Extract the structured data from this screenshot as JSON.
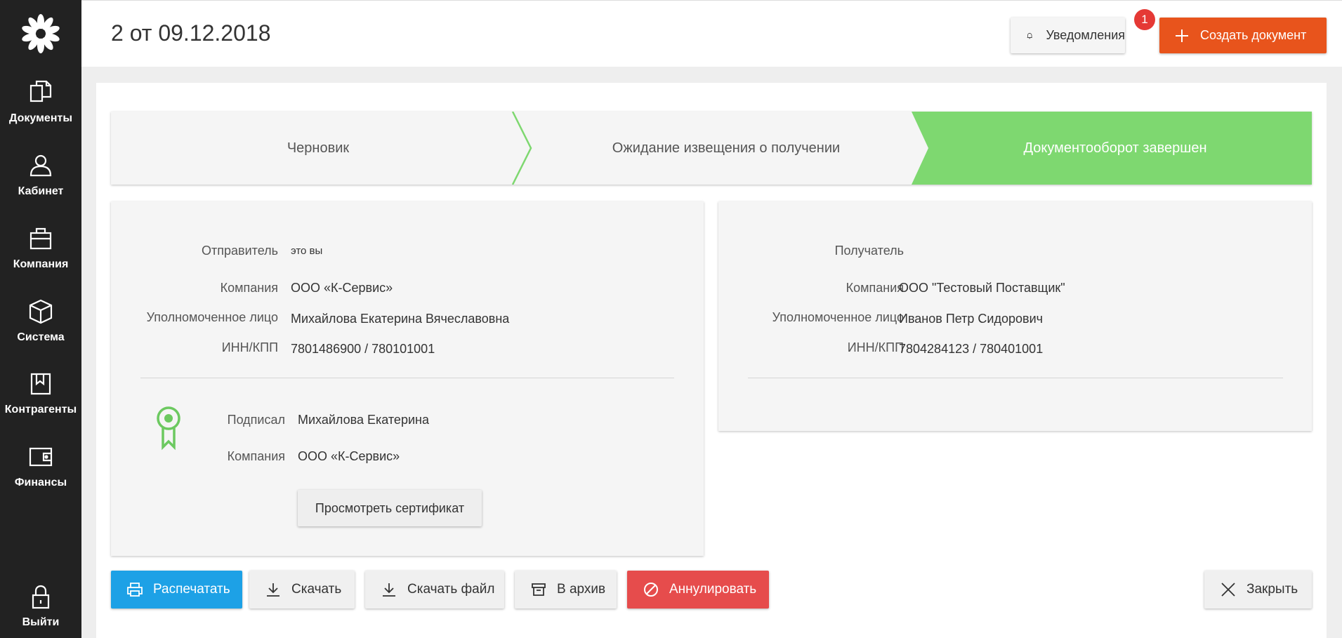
{
  "header": {
    "title": "2 от 09.12.2018",
    "notifications_label": "Уведомления",
    "notifications_count": "1",
    "create_label": "Создать документ"
  },
  "sidebar": {
    "items": [
      {
        "label": "Документы",
        "icon": "documents-icon"
      },
      {
        "label": "Кабинет",
        "icon": "user-icon"
      },
      {
        "label": "Компания",
        "icon": "briefcase-icon"
      },
      {
        "label": "Система",
        "icon": "box-icon"
      },
      {
        "label": "Контрагенты",
        "icon": "bookmark-book-icon"
      },
      {
        "label": "Финансы",
        "icon": "wallet-icon"
      }
    ],
    "logout_label": "Выйти"
  },
  "stepper": {
    "steps": [
      {
        "label": "Черновик",
        "state": "done"
      },
      {
        "label": "Ожидание извещения о получении",
        "state": "done"
      },
      {
        "label": "Документооборот завершен",
        "state": "active"
      }
    ],
    "active_color": "#7ed870"
  },
  "sender": {
    "title_label": "Отправитель",
    "title_value": "это вы",
    "company_label": "Компания",
    "company_value": "ООО «К-Сервис»",
    "person_label": "Уполномоченное лицо",
    "person_value": "Михайлова Екатерина Вячеславовна",
    "inn_label": "ИНН/КПП",
    "inn_value": "7801486900 / 780101001",
    "signed_label": "Подписал",
    "signed_value": "Михайлова Екатерина",
    "sign_company_label": "Компания",
    "sign_company_value": "ООО «К-Сервис»",
    "cert_button": "Просмотреть сертификат"
  },
  "recipient": {
    "title_label": "Получатель",
    "company_label": "Компания",
    "company_value": "ООО \"Тестовый Поставщик\"",
    "person_label": "Уполномоченное лицо",
    "person_value": "Иванов Петр Сидорович",
    "inn_label": "ИНН/КПП",
    "inn_value": "7804284123 / 780401001"
  },
  "actions": {
    "print": "Распечатать",
    "download": "Скачать",
    "download_file": "Скачать файл",
    "archive": "В архив",
    "annul": "Аннулировать",
    "close": "Закрыть"
  },
  "colors": {
    "accent_orange": "#e8541c",
    "primary_blue": "#1da1e6",
    "danger_red": "#e64c4c",
    "success_green": "#7ed870",
    "sidebar_bg": "#222222"
  }
}
